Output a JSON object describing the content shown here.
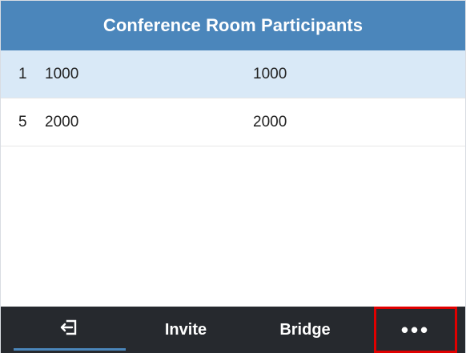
{
  "title": "Conference Room Participants",
  "participants": [
    {
      "index": "1",
      "name": "1000",
      "number": "1000",
      "selected": true
    },
    {
      "index": "5",
      "name": "2000",
      "number": "2000",
      "selected": false
    }
  ],
  "softkeys": {
    "exit_icon": "exit-icon",
    "invite": "Invite",
    "bridge": "Bridge",
    "more": "•••"
  },
  "colors": {
    "title_bar": "#4b86bb",
    "selected_row": "#d9e9f7",
    "softkey_bar": "#26292e",
    "highlight_box": "#e00000"
  }
}
